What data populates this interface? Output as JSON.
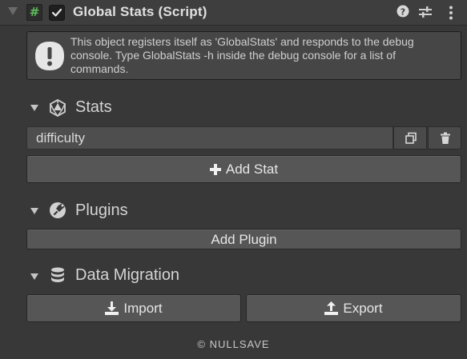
{
  "component": {
    "title": "Global Stats (Script)",
    "enabled": true,
    "script_icon_glyph": "#",
    "icons": [
      "foldout-arrow-icon",
      "script-icon",
      "enable-checkbox",
      "help-icon",
      "presets-icon",
      "context-menu-icon"
    ]
  },
  "help": {
    "text": "This object registers itself as 'GlobalStats' and responds to the debug console. Type GlobalStats -h inside the debug console for a list of commands."
  },
  "sections": {
    "stats": {
      "label": "Stats",
      "icon": "d20-dice-icon"
    },
    "plugins": {
      "label": "Plugins",
      "icon": "plug-icon"
    },
    "data_migration": {
      "label": "Data Migration",
      "icon": "database-icon"
    }
  },
  "stats_list": [
    {
      "name": "difficulty"
    }
  ],
  "buttons": {
    "add_stat": "Add Stat",
    "add_plugin": "Add Plugin",
    "import": "Import",
    "export": "Export"
  },
  "footer": {
    "text": "© NULLSAVE"
  },
  "colors": {
    "background": "#383838",
    "header": "#3e3e3e",
    "button": "#565656",
    "script_icon": "#5fbe5a"
  }
}
